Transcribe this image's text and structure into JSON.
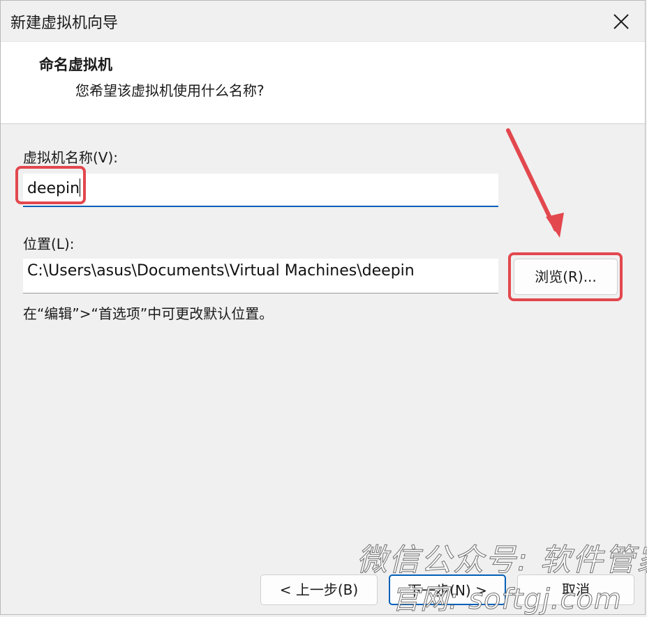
{
  "window": {
    "title": "新建虚拟机向导"
  },
  "header": {
    "title": "命名虚拟机",
    "subtitle": "您希望该虚拟机使用什么名称?"
  },
  "form": {
    "name_label": "虚拟机名称(V):",
    "name_value": "deepin",
    "location_label": "位置(L):",
    "location_value": "C:\\Users\\asus\\Documents\\Virtual Machines\\deepin",
    "browse_label": "浏览(R)...",
    "hint": "在“编辑”>“首选项”中可更改默认位置。"
  },
  "footer": {
    "back_label": "< 上一步(B)",
    "next_label": "下一步(N) >",
    "cancel_label": "取消"
  },
  "watermark": {
    "line1": "微信公众号: 软件管家",
    "line2": "官网: softgj.com"
  },
  "colors": {
    "accent": "#005fb8",
    "highlight": "#e2484e",
    "background": "#f0f0f0"
  },
  "icons": {
    "close": "close-icon",
    "annotation_arrow": "arrow-icon"
  }
}
